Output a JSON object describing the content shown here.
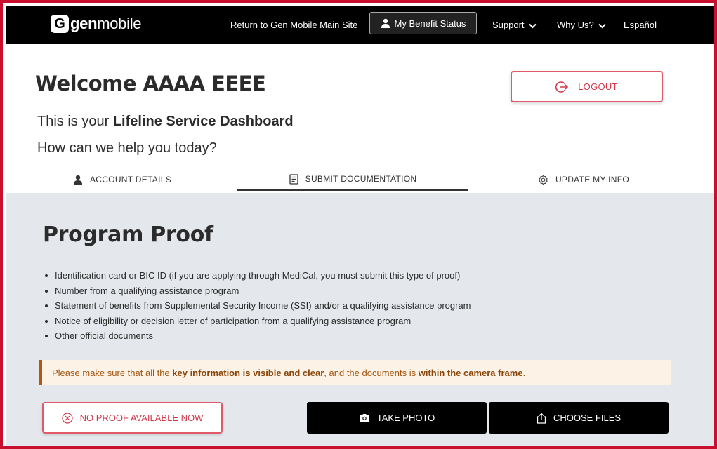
{
  "header": {
    "logo_mark": "G",
    "logo_text_bold": "gen",
    "logo_text_rest": "mobile",
    "nav": {
      "main_site": "Return to Gen Mobile Main Site",
      "benefit_status": "My Benefit Status",
      "support": "Support",
      "why_us": "Why Us?",
      "espanol": "Español"
    }
  },
  "welcome": {
    "title": "Welcome AAAA EEEE",
    "logout_label": "LOGOUT",
    "dashboard_prefix": "This is your ",
    "dashboard_name": "Lifeline Service Dashboard",
    "help_text": "How can we help you today?"
  },
  "tabs": [
    {
      "label": "ACCOUNT DETAILS",
      "icon": "person-icon",
      "active": false
    },
    {
      "label": "SUBMIT DOCUMENTATION",
      "icon": "document-icon",
      "active": true
    },
    {
      "label": "UPDATE MY INFO",
      "icon": "gear-icon",
      "active": false
    }
  ],
  "proof": {
    "title": "Program Proof",
    "items": [
      "Identification card or BIC ID (if you are applying through MediCal, you must submit this type of proof)",
      "Number from a qualifying assistance program",
      "Statement of benefits from Supplemental Security Income (SSI) and/or a qualifying assistance program",
      "Notice of eligibility or decision letter of participation from a qualifying assistance program",
      "Other official documents"
    ],
    "notice": {
      "part1": "Please make sure that all the ",
      "bold1": "key information is visible and clear",
      "part2": ", and the documents is ",
      "bold2": "within the camera frame",
      "part3": "."
    },
    "buttons": {
      "no_proof": "NO PROOF AVAILABLE NOW",
      "take_photo": "TAKE PHOTO",
      "choose_files": "CHOOSE FILES"
    }
  },
  "colors": {
    "brand_red": "#c8102e",
    "header_bg": "#000000",
    "content_bg": "#e4e8ec",
    "notice_bg": "#fdf2e6",
    "notice_accent": "#b8560f"
  }
}
